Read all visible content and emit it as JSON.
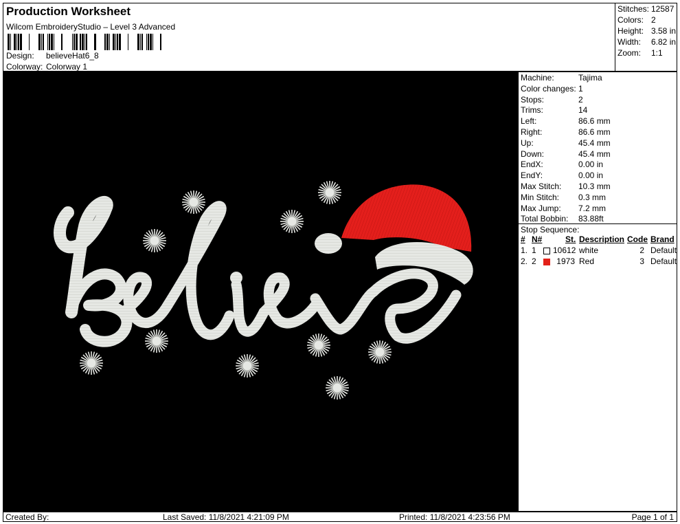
{
  "header": {
    "title": "Production Worksheet",
    "software": "Wilcom EmbroideryStudio – Level 3 Advanced",
    "design_label": "Design:",
    "design_value": "believeHat6_8",
    "colorway_label": "Colorway:",
    "colorway_value": "Colorway 1"
  },
  "summary": {
    "stitches_label": "Stitches:",
    "stitches_value": "12587",
    "colors_label": "Colors:",
    "colors_value": "2",
    "height_label": "Height:",
    "height_value": "3.58 in",
    "width_label": "Width:",
    "width_value": "6.82 in",
    "zoom_label": "Zoom:",
    "zoom_value": "1:1"
  },
  "details": [
    {
      "label": "Machine:",
      "value": "Tajima"
    },
    {
      "label": "Color changes:",
      "value": "1"
    },
    {
      "label": "Stops:",
      "value": "2"
    },
    {
      "label": "Trims:",
      "value": "14"
    },
    {
      "label": "Left:",
      "value": "86.6 mm"
    },
    {
      "label": "Right:",
      "value": "86.6 mm"
    },
    {
      "label": "Up:",
      "value": "45.4 mm"
    },
    {
      "label": "Down:",
      "value": "45.4 mm"
    },
    {
      "label": "EndX:",
      "value": "0.00 in"
    },
    {
      "label": "EndY:",
      "value": "0.00 in"
    },
    {
      "label": "Max Stitch:",
      "value": "10.3 mm"
    },
    {
      "label": "Min Stitch:",
      "value": "0.3 mm"
    },
    {
      "label": "Max Jump:",
      "value": "7.2 mm"
    },
    {
      "label": "Total Bobbin:",
      "value": "83.88ft"
    }
  ],
  "stop_sequence": {
    "title": "Stop Sequence:",
    "headers": {
      "num": "#",
      "needle": "N#",
      "stitches": "St.",
      "description": "Description",
      "code": "Code",
      "brand": "Brand"
    },
    "rows": [
      {
        "num": "1.",
        "needle": "1",
        "color": "#ffffff",
        "stitches": "10612",
        "description": "white",
        "code": "2",
        "brand": "Default"
      },
      {
        "num": "2.",
        "needle": "2",
        "color": "#e32119",
        "stitches": "1973",
        "description": "Red",
        "code": "3",
        "brand": "Default"
      }
    ]
  },
  "design_preview": {
    "word": "Believe",
    "thread_white": "#e6e8e4",
    "thread_red": "#e41f1c",
    "background": "#000000"
  },
  "footer": {
    "created_by": "Created By:",
    "last_saved": "Last Saved: 11/8/2021 4:21:09 PM",
    "printed": "Printed: 11/8/2021 4:23:56 PM",
    "page": "Page 1 of 1"
  }
}
